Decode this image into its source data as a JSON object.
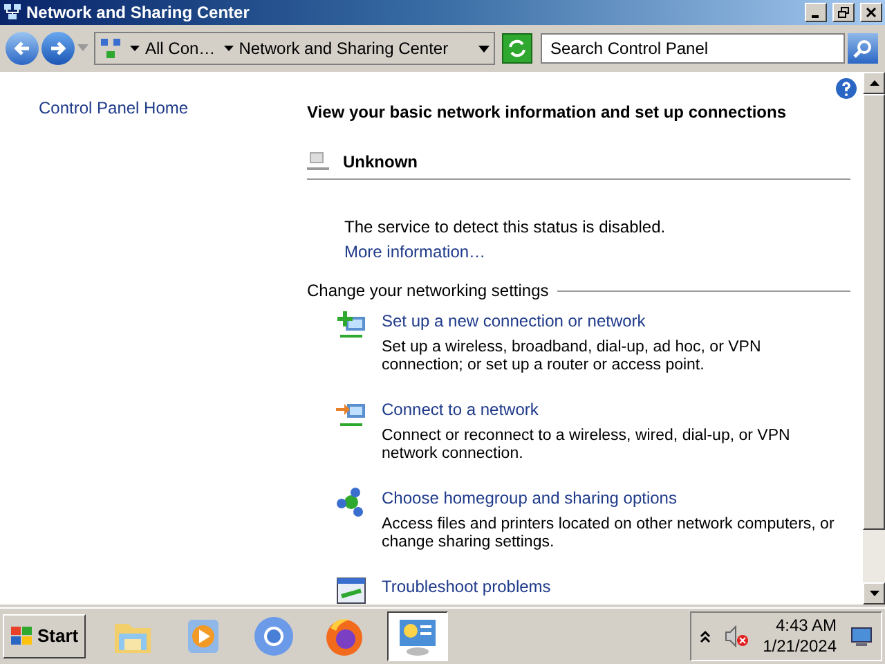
{
  "window": {
    "title": "Network and Sharing Center"
  },
  "address_bar": {
    "crumbs": [
      "All Con…",
      "Network and Sharing Center"
    ]
  },
  "search": {
    "placeholder": "Search Control Panel"
  },
  "sidebar": {
    "items": [
      "Control Panel Home"
    ]
  },
  "main": {
    "heading": "View your basic network information and set up connections",
    "network": {
      "name": "Unknown",
      "status": "The service to detect this status is disabled.",
      "link": "More information…"
    },
    "section_title": "Change your networking settings",
    "tasks": [
      {
        "kind": "new-connection",
        "title": "Set up a new connection or network",
        "description": "Set up a wireless, broadband, dial-up, ad hoc, or VPN connection; or set up a router or access point."
      },
      {
        "kind": "connect",
        "title": "Connect to a network",
        "description": "Connect or reconnect to a wireless, wired, dial-up, or VPN network connection."
      },
      {
        "kind": "homegroup",
        "title": "Choose homegroup and sharing options",
        "description": "Access files and printers located on other network computers, or change sharing settings."
      },
      {
        "kind": "troubleshoot",
        "title": "Troubleshoot problems"
      }
    ]
  },
  "taskbar": {
    "start": "Start",
    "apps": [
      {
        "kind": "folder",
        "selected": false
      },
      {
        "kind": "media",
        "selected": false
      },
      {
        "kind": "chrome",
        "selected": false
      },
      {
        "kind": "firefox",
        "selected": false
      },
      {
        "kind": "control-panel",
        "selected": true
      }
    ],
    "clock": {
      "time": "4:43 AM",
      "date": "1/21/2024"
    }
  }
}
